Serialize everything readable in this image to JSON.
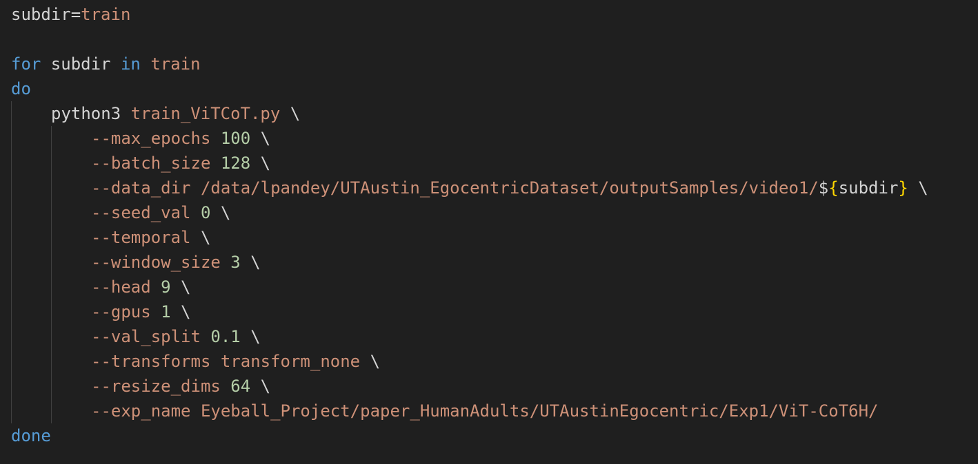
{
  "editor": {
    "theme": {
      "background": "#1f1f1f",
      "plain": "#d4d4d4",
      "keyword": "#569cd6",
      "string": "#ce9178",
      "number": "#b5cea8",
      "brace": "#ffd700",
      "indent_guide": "#404040"
    },
    "lines": [
      {
        "indent": 0,
        "tokens": [
          {
            "t": "subdir=",
            "k": "plain"
          },
          {
            "t": "train",
            "k": "str"
          }
        ]
      },
      {
        "indent": 0,
        "tokens": []
      },
      {
        "indent": 0,
        "tokens": [
          {
            "t": "for",
            "k": "kw"
          },
          {
            "t": " subdir ",
            "k": "plain"
          },
          {
            "t": "in",
            "k": "kw"
          },
          {
            "t": " ",
            "k": "plain"
          },
          {
            "t": "train",
            "k": "str"
          }
        ]
      },
      {
        "indent": 0,
        "tokens": [
          {
            "t": "do",
            "k": "kw"
          }
        ]
      },
      {
        "indent": 1,
        "tokens": [
          {
            "t": "python3 ",
            "k": "plain"
          },
          {
            "t": "train_ViTCoT.py",
            "k": "str"
          },
          {
            "t": " \\",
            "k": "plain"
          }
        ]
      },
      {
        "indent": 2,
        "tokens": [
          {
            "t": "--max_epochs",
            "k": "str"
          },
          {
            "t": " ",
            "k": "plain"
          },
          {
            "t": "100",
            "k": "num"
          },
          {
            "t": " \\",
            "k": "plain"
          }
        ]
      },
      {
        "indent": 2,
        "tokens": [
          {
            "t": "--batch_size",
            "k": "str"
          },
          {
            "t": " ",
            "k": "plain"
          },
          {
            "t": "128",
            "k": "num"
          },
          {
            "t": " \\",
            "k": "plain"
          }
        ]
      },
      {
        "indent": 2,
        "tokens": [
          {
            "t": "--data_dir /data/lpandey/UTAustin_EgocentricDataset/outputSamples/video1/",
            "k": "str"
          },
          {
            "t": "$",
            "k": "plain"
          },
          {
            "t": "{",
            "k": "brace"
          },
          {
            "t": "subdir",
            "k": "plain"
          },
          {
            "t": "}",
            "k": "brace"
          },
          {
            "t": " \\",
            "k": "plain"
          }
        ]
      },
      {
        "indent": 2,
        "tokens": [
          {
            "t": "--seed_val",
            "k": "str"
          },
          {
            "t": " ",
            "k": "plain"
          },
          {
            "t": "0",
            "k": "num"
          },
          {
            "t": " \\",
            "k": "plain"
          }
        ]
      },
      {
        "indent": 2,
        "tokens": [
          {
            "t": "--temporal",
            "k": "str"
          },
          {
            "t": " \\",
            "k": "plain"
          }
        ]
      },
      {
        "indent": 2,
        "tokens": [
          {
            "t": "--window_size",
            "k": "str"
          },
          {
            "t": " ",
            "k": "plain"
          },
          {
            "t": "3",
            "k": "num"
          },
          {
            "t": " \\",
            "k": "plain"
          }
        ]
      },
      {
        "indent": 2,
        "tokens": [
          {
            "t": "--head",
            "k": "str"
          },
          {
            "t": " ",
            "k": "plain"
          },
          {
            "t": "9",
            "k": "num"
          },
          {
            "t": " \\",
            "k": "plain"
          }
        ]
      },
      {
        "indent": 2,
        "tokens": [
          {
            "t": "--gpus",
            "k": "str"
          },
          {
            "t": " ",
            "k": "plain"
          },
          {
            "t": "1",
            "k": "num"
          },
          {
            "t": " \\",
            "k": "plain"
          }
        ]
      },
      {
        "indent": 2,
        "tokens": [
          {
            "t": "--val_split",
            "k": "str"
          },
          {
            "t": " ",
            "k": "plain"
          },
          {
            "t": "0.1",
            "k": "num"
          },
          {
            "t": " \\",
            "k": "plain"
          }
        ]
      },
      {
        "indent": 2,
        "tokens": [
          {
            "t": "--transforms transform_none",
            "k": "str"
          },
          {
            "t": " \\",
            "k": "plain"
          }
        ]
      },
      {
        "indent": 2,
        "tokens": [
          {
            "t": "--resize_dims",
            "k": "str"
          },
          {
            "t": " ",
            "k": "plain"
          },
          {
            "t": "64",
            "k": "num"
          },
          {
            "t": " \\",
            "k": "plain"
          }
        ]
      },
      {
        "indent": 2,
        "tokens": [
          {
            "t": "--exp_name Eyeball_Project/paper_HumanAdults/UTAustinEgocentric/Exp1/ViT-CoT6H/",
            "k": "str"
          }
        ]
      },
      {
        "indent": 0,
        "tokens": [
          {
            "t": "done",
            "k": "kw"
          }
        ]
      }
    ]
  }
}
